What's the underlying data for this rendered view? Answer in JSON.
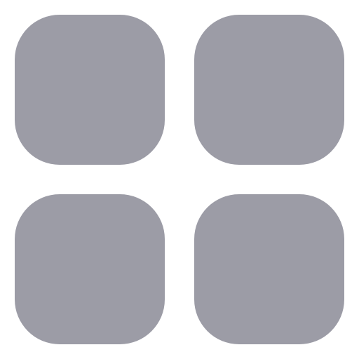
{
  "icon": {
    "name": "grid-icon",
    "tile_color": "#9c9ca6",
    "background_color": "#ffffff"
  }
}
